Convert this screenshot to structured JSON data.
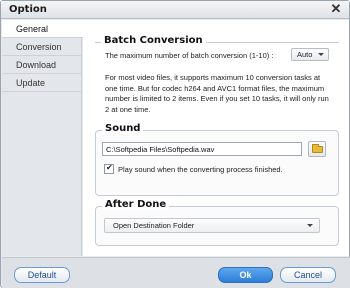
{
  "window": {
    "title": "Option"
  },
  "sidebar": {
    "items": [
      {
        "label": "General"
      },
      {
        "label": "Conversion"
      },
      {
        "label": "Download"
      },
      {
        "label": "Update"
      }
    ]
  },
  "batch": {
    "title": "Batch Conversion",
    "max_label": "The maximum number of batch conversion (1-10) :",
    "max_value": "Auto",
    "description": "For most video files, it supports maximum 10 conversion tasks at one time. But for codec h264 and AVC1 format files, the maximum number is limited to 2 items. Even if you set 10 tasks, it will only run 2 at one time."
  },
  "sound": {
    "title": "Sound",
    "path_value": "C:\\Softpedia Files\\Softpedia.wav",
    "play_label": "Play sound when the converting process finished.",
    "play_checked": true
  },
  "after_done": {
    "title": "After Done",
    "selected": "Open Destination Folder"
  },
  "footer": {
    "default_label": "Default",
    "ok_label": "Ok",
    "cancel_label": "Cancel"
  },
  "colors": {
    "accent": "#2c7ed8",
    "folder": "#e9b93a"
  }
}
